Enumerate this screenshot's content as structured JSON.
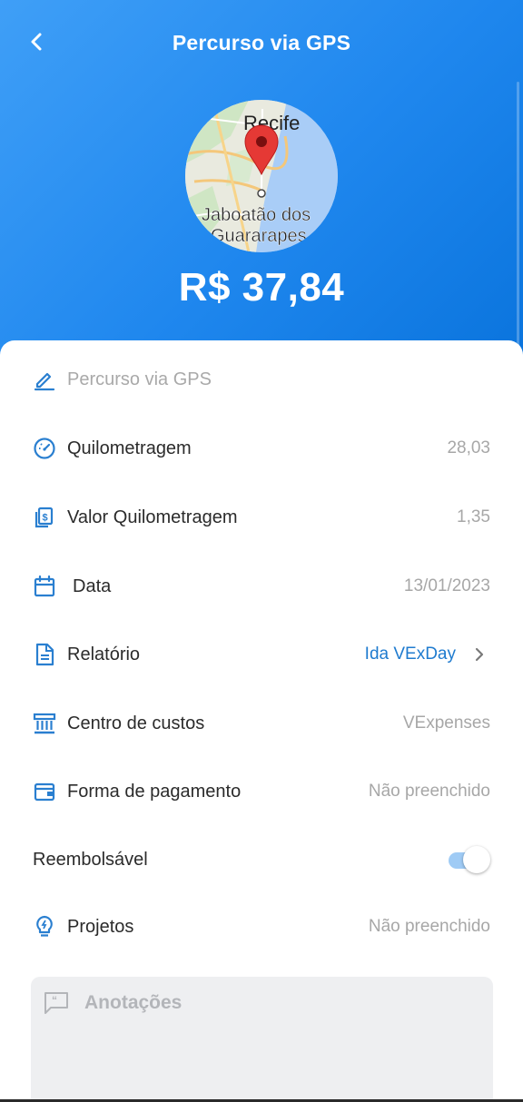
{
  "header": {
    "title": "Percurso via GPS",
    "amount": "R$ 37,84",
    "map": {
      "city_top": "Recife",
      "city_bottom_line1": "Jaboatão dos",
      "city_bottom_line2": "Guararapes"
    }
  },
  "colors": {
    "accent": "#1f87ee",
    "link": "#1f7bcf",
    "icon": "#2a7fd0"
  },
  "fields": {
    "description": {
      "placeholder": "Percurso via GPS",
      "icon": "pencil-icon"
    },
    "mileage": {
      "label": "Quilometragem",
      "value": "28,03",
      "icon": "speedometer-icon"
    },
    "mileage_rate": {
      "label": "Valor Quilometragem",
      "value": "1,35",
      "icon": "money-copy-icon"
    },
    "date": {
      "label": "Data",
      "value": "13/01/2023",
      "icon": "calendar-icon"
    },
    "report": {
      "label": "Relatório",
      "value": "Ida VExDay",
      "icon": "document-icon"
    },
    "cost_center": {
      "label": "Centro de custos",
      "value": "VExpenses",
      "icon": "bank-icon"
    },
    "payment": {
      "label": "Forma de pagamento",
      "value": "Não preenchido",
      "icon": "wallet-icon"
    },
    "reimbursable": {
      "label": "Reembolsável",
      "on": true
    },
    "projects": {
      "label": "Projetos",
      "value": "Não preenchido",
      "icon": "lightbulb-icon"
    }
  },
  "notes": {
    "placeholder": "Anotações",
    "icon": "comment-icon"
  }
}
